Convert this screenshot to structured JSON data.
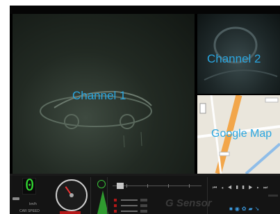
{
  "viewer": {
    "channel1": {
      "label": "Channel 1"
    },
    "channel2": {
      "label": "Channel 2"
    },
    "map": {
      "label": "Google Map"
    }
  },
  "dashboard": {
    "speed_value": "0",
    "speed_unit": "km/h",
    "speed_label": "CAR SPEED",
    "gsensor_label": "G Sensor"
  },
  "colors": {
    "label_blue": "#2aa6e0",
    "digit_green": "#34e334",
    "accent_red": "#b31818"
  },
  "icons": {
    "playback": [
      "skip-back-icon",
      "step-back-icon",
      "rewind-icon",
      "pause-icon",
      "play-icon",
      "step-forward-icon",
      "skip-forward-icon"
    ],
    "tools": [
      "save-icon",
      "snapshot-icon",
      "settings-icon",
      "folder-icon",
      "arrow-icon"
    ]
  }
}
